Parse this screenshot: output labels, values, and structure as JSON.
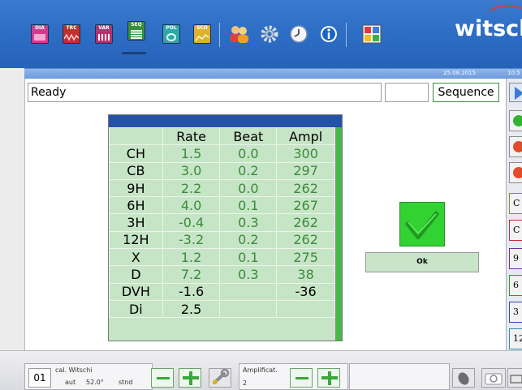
{
  "toolbar": {
    "icons": [
      {
        "name": "dia-icon",
        "label": "DIA"
      },
      {
        "name": "trc-icon",
        "label": "TRC"
      },
      {
        "name": "var-icon",
        "label": "VAR"
      },
      {
        "name": "seq-icon",
        "label": "SEQ"
      },
      {
        "name": "pol-icon",
        "label": "POL"
      },
      {
        "name": "sco-icon",
        "label": "SCO"
      },
      {
        "name": "users-icon",
        "label": ""
      },
      {
        "name": "gear-icon",
        "label": ""
      },
      {
        "name": "clock-icon",
        "label": ""
      },
      {
        "name": "info-icon",
        "label": ""
      },
      {
        "name": "layout-icon",
        "label": ""
      }
    ],
    "brand": "witsch"
  },
  "datebar": {
    "date": "25.08.2015",
    "time": "10:5"
  },
  "status": {
    "text": "Ready",
    "sequence_label": "Sequence"
  },
  "table": {
    "headers": [
      "",
      "Rate",
      "Beat",
      "Ampl"
    ],
    "rows": [
      {
        "label": "CH",
        "rate": "1.5",
        "beat": "0.0",
        "ampl": "300"
      },
      {
        "label": "CB",
        "rate": "3.0",
        "beat": "0.2",
        "ampl": "297"
      },
      {
        "label": "9H",
        "rate": "2.2",
        "beat": "0.0",
        "ampl": "262"
      },
      {
        "label": "6H",
        "rate": "4.0",
        "beat": "0.1",
        "ampl": "267"
      },
      {
        "label": "3H",
        "rate": "-0.4",
        "beat": "0.3",
        "ampl": "262"
      },
      {
        "label": "12H",
        "rate": "-3.2",
        "beat": "0.2",
        "ampl": "262"
      },
      {
        "label": "X",
        "rate": "1.2",
        "beat": "0.1",
        "ampl": "275"
      },
      {
        "label": "D",
        "rate": "7.2",
        "beat": "0.3",
        "ampl": "38"
      },
      {
        "label": "DVH",
        "rate": "-1.6",
        "beat": "",
        "ampl": "-36"
      },
      {
        "label": "Di",
        "rate": "2.5",
        "beat": "",
        "ampl": ""
      }
    ]
  },
  "ok_label": "Ok",
  "right_buttons": [
    "C",
    "C",
    "9",
    "6",
    "3",
    "12"
  ],
  "bottom": {
    "channel": "01",
    "cal_name": "cal. Witschi",
    "mode": "aut",
    "angle": "52.0°",
    "position": "stnd",
    "amplificat_label": "Amplificat.",
    "amplificat_value": "2"
  },
  "colors": {
    "toolbar_blue": "#2f6fc6",
    "table_green": "#c6e5c6",
    "value_green": "#3a8a3a",
    "check_green": "#33d233"
  }
}
